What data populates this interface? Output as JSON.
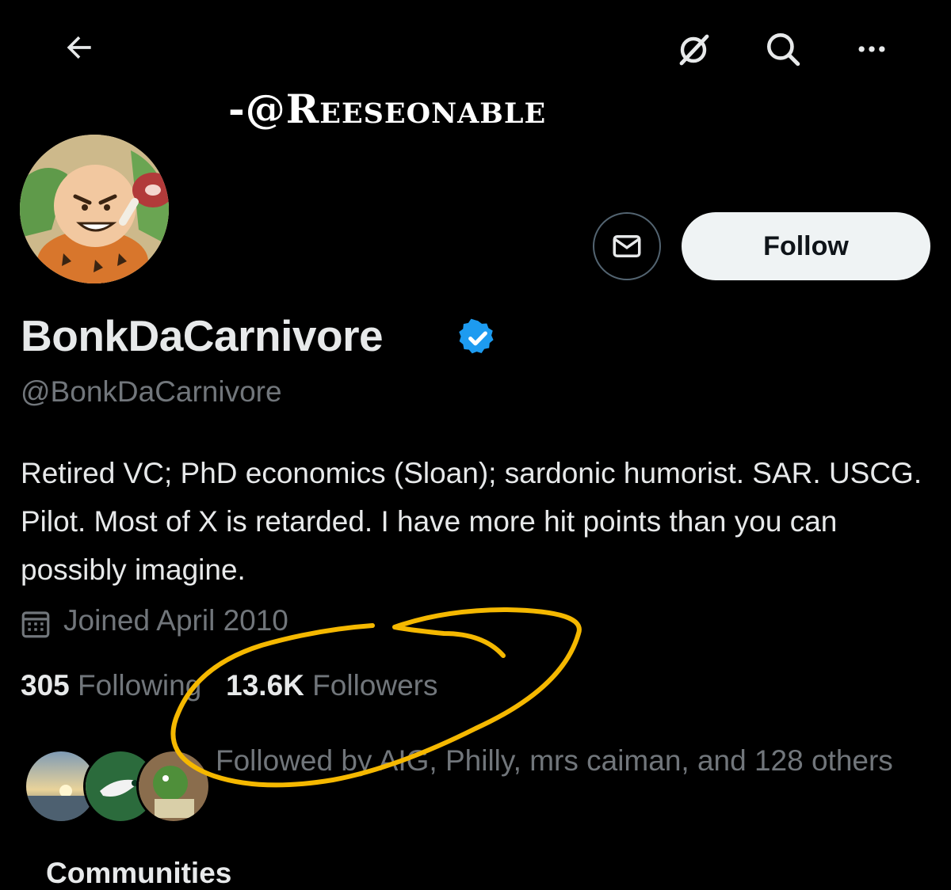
{
  "watermark": "-@Reeseonable",
  "header": {
    "back_icon": "arrow-left-icon",
    "grok_icon": "grok-icon",
    "search_icon": "search-icon",
    "more_icon": "more-horizontal-icon"
  },
  "profile": {
    "display_name": "BonkDaCarnivore",
    "handle": "@BonkDaCarnivore",
    "verified": true,
    "bio": "Retired VC; PhD economics (Sloan); sardonic humorist. SAR. USCG. Pilot. Most of X is retarded. I have more hit points than you can possibly imagine.",
    "joined": "Joined April 2010",
    "following_count": "305",
    "following_label": "Following",
    "followers_count": "13.6K",
    "followers_label": "Followers",
    "followed_by": "Followed by AIG, Philly, mrs caiman, and 128 others"
  },
  "actions": {
    "follow_label": "Follow",
    "message_icon": "mail-icon"
  },
  "colors": {
    "background": "#000000",
    "text_primary": "#e7e9ea",
    "text_secondary": "#71767b",
    "verified_blue": "#1d9bf0",
    "annotation_yellow": "#f5b800"
  },
  "bottom_peek": "Communities"
}
